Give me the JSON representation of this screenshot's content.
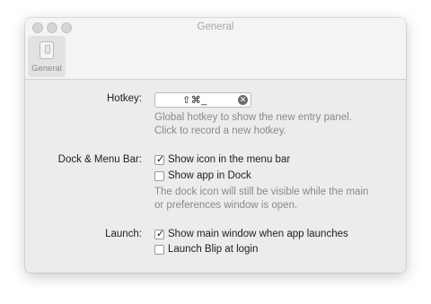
{
  "window": {
    "title": "General",
    "tabs": [
      {
        "label": "General",
        "icon": "phone-device-icon"
      }
    ]
  },
  "hotkey": {
    "label": "Hotkey:",
    "value": "⇧⌘_",
    "help": [
      "Global hotkey to show the new entry panel.",
      "Click to record a new hotkey."
    ]
  },
  "dock_menu_bar": {
    "label": "Dock & Menu Bar:",
    "options": [
      {
        "label": "Show icon in the menu bar",
        "checked": true
      },
      {
        "label": "Show app in Dock",
        "checked": false
      }
    ],
    "help": [
      "The dock icon will still be visible while the main",
      "or preferences window is open."
    ]
  },
  "launch": {
    "label": "Launch:",
    "options": [
      {
        "label": "Show main window when app launches",
        "checked": true
      },
      {
        "label": "Launch Blip at login",
        "checked": false
      }
    ]
  }
}
